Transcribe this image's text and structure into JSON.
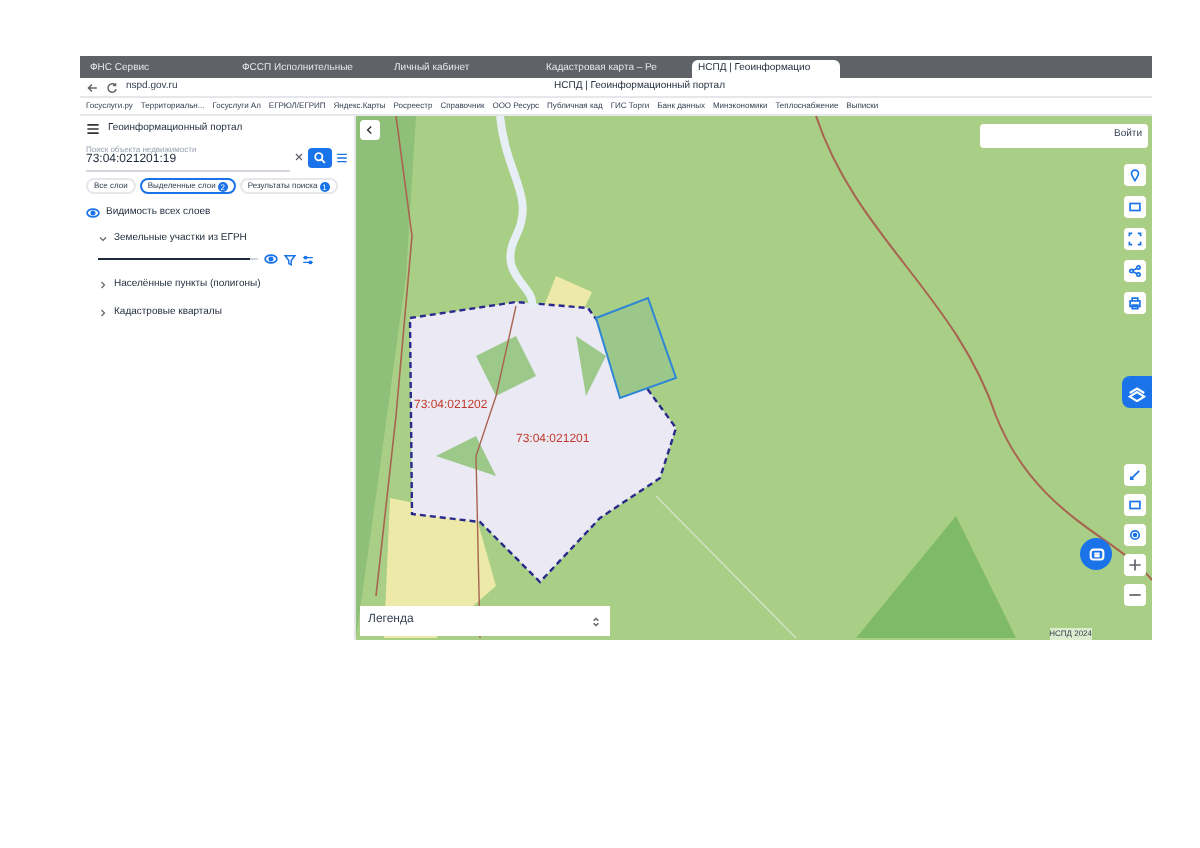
{
  "browser": {
    "tabs": [
      {
        "label": "ФНС Сервис",
        "selected": false
      },
      {
        "label": "ФССП Исполнительные",
        "selected": false
      },
      {
        "label": "Личный кабинет",
        "selected": false
      },
      {
        "label": "Кадастровая карта – Ре",
        "selected": false
      },
      {
        "label": "НСПД | Геоинформацио",
        "selected": true
      }
    ],
    "address": "nspd.gov.ru",
    "page_title": "НСПД | Геоинформационный портал",
    "bookmarks": [
      "Госуслуги.ру",
      "Территориальн...",
      "Госуслуги Ал",
      "ЕГРЮЛ/ЕГРИП",
      "Яндекс.Карты",
      "Росреестр",
      "Справочник",
      "ООО Ресурс",
      "Публичная кад",
      "ГИС Торги",
      "Банк данных",
      "Минэкономики",
      "Теплоснабжение",
      "Выписки"
    ]
  },
  "panel": {
    "title": "Геоинформационный портал",
    "search": {
      "label": "Поиск объекта недвижимости",
      "value": "73:04:021201:19"
    },
    "chips": [
      {
        "label": "Все слои",
        "selected": false
      },
      {
        "label": "Выделенные слои",
        "count": "2",
        "selected": true
      },
      {
        "label": "Результаты поиска",
        "count": "1",
        "selected": false
      }
    ],
    "visibility": "Видимость всех слоев",
    "layers": [
      {
        "label": "Земельные участки из ЕГРН",
        "expanded": true,
        "level": 0.95
      },
      {
        "label": "Населённые пункты (полигоны)",
        "expanded": false
      },
      {
        "label": "Кадастровые кварталы",
        "expanded": false
      }
    ]
  },
  "map": {
    "labels": [
      "73:04:021202",
      "73:04:021201"
    ],
    "login": "Войти",
    "legend": "Легенда",
    "attribution": "НСПД 2024"
  }
}
